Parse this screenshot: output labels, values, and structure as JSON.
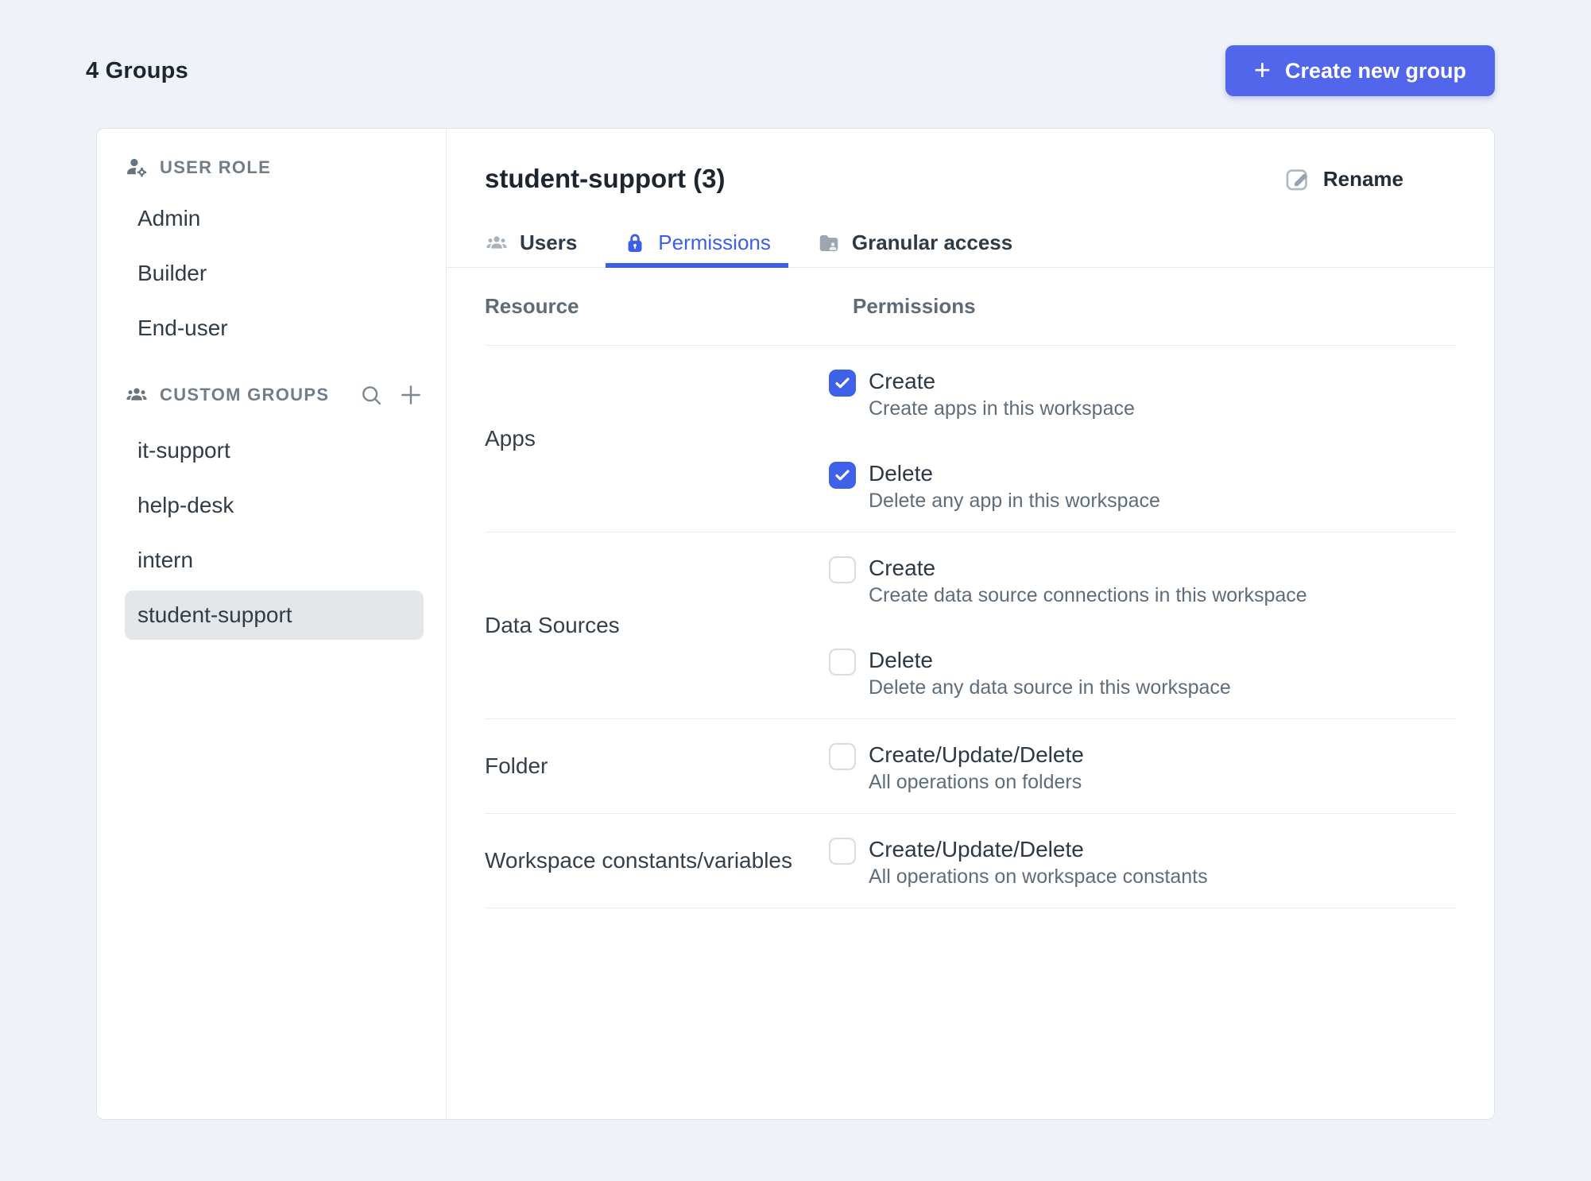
{
  "page": {
    "title": "4 Groups"
  },
  "create_button": {
    "label": "Create new group",
    "plus": "+"
  },
  "sidebar": {
    "user_role": {
      "label": "USER ROLE",
      "items": [
        "Admin",
        "Builder",
        "End-user"
      ]
    },
    "custom_groups": {
      "label": "CUSTOM GROUPS",
      "items": [
        "it-support",
        "help-desk",
        "intern",
        "student-support"
      ],
      "selected": "student-support"
    }
  },
  "main": {
    "title": "student-support (3)",
    "rename_label": "Rename",
    "tabs": [
      {
        "label": "Users",
        "active": false
      },
      {
        "label": "Permissions",
        "active": true
      },
      {
        "label": "Granular access",
        "active": false
      }
    ],
    "table": {
      "headers": {
        "resource": "Resource",
        "permissions": "Permissions"
      },
      "rows": [
        {
          "resource": "Apps",
          "permissions": [
            {
              "label": "Create",
              "description": "Create apps in this workspace",
              "checked": true
            },
            {
              "label": "Delete",
              "description": "Delete any app in this workspace",
              "checked": true
            }
          ]
        },
        {
          "resource": "Data Sources",
          "permissions": [
            {
              "label": "Create",
              "description": "Create data source connections in this workspace",
              "checked": false
            },
            {
              "label": "Delete",
              "description": "Delete any data source in this workspace",
              "checked": false
            }
          ]
        },
        {
          "resource": "Folder",
          "permissions": [
            {
              "label": "Create/Update/Delete",
              "description": "All operations on folders",
              "checked": false
            }
          ]
        },
        {
          "resource": "Workspace constants/variables",
          "permissions": [
            {
              "label": "Create/Update/Delete",
              "description": "All operations on workspace constants",
              "checked": false
            }
          ]
        }
      ]
    }
  },
  "colors": {
    "accent_blue": "#3e61e9",
    "button_blue": "#5266ec",
    "page_background": "#eff3f8",
    "selected_item_background": "#e3e7ea"
  }
}
